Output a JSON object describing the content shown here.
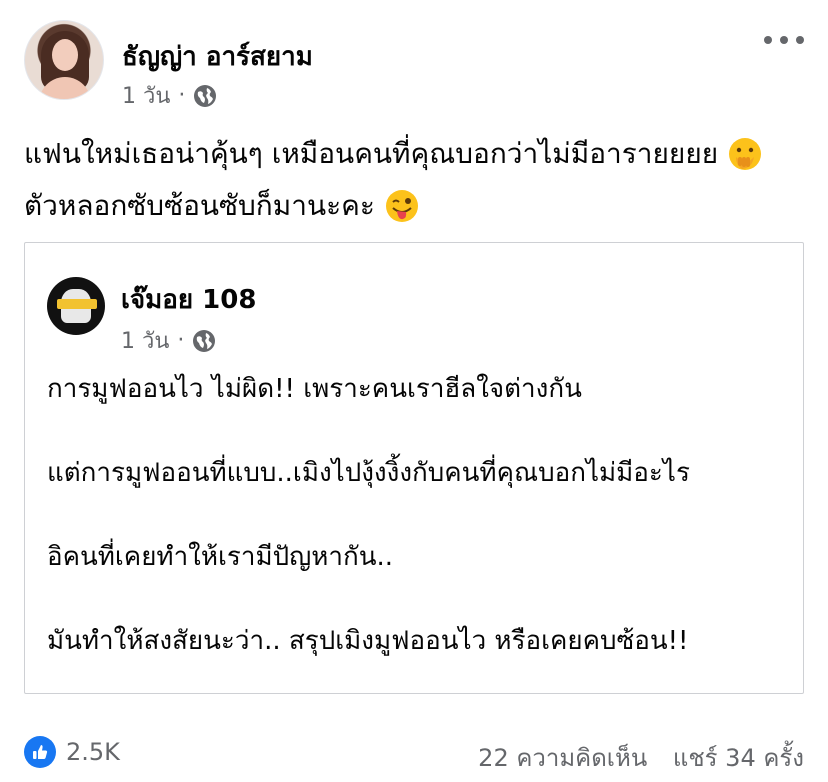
{
  "post": {
    "author": "ธัญญ่า อาร์สยาม",
    "time": "1 วัน",
    "separator": "·",
    "audience_icon": "globe-icon",
    "more_icon": "more-options-icon",
    "text_line1": "แฟนใหม่เธอน่าคุ้นๆ เหมือนคนที่คุณบอกว่าไม่มีอารายยยย",
    "text_line1_emoji": "hand-over-mouth-emoji",
    "text_line2": "ตัวหลอกซับซ้อนซับก็มานะคะ",
    "text_line2_emoji": "winking-tongue-emoji"
  },
  "shared_post": {
    "author": "เจ๊มอย 108",
    "time": "1 วัน",
    "separator": "·",
    "audience_icon": "globe-icon",
    "paragraphs": [
      "การมูฟออนไว ไม่ผิด!! เพราะคนเราฮีลใจต่างกัน",
      "แต่การมูฟออนที่แบบ..เมิงไปงุ้งงิ้งกับคนที่คุณบอกไม่มีอะไร",
      "อิคนที่เคยทำให้เรามีปัญหากัน..",
      "มันทำให้สงสัยนะว่า.. สรุปเมิงมูฟออนไว หรือเคยคบซ้อน!!"
    ]
  },
  "footer": {
    "reaction_icon": "like-icon",
    "reaction_count": "2.5K",
    "comments": "22 ความคิดเห็น",
    "shares": "แชร์ 34 ครั้ง"
  },
  "colors": {
    "accent": "#1877f2",
    "text_primary": "#050505",
    "text_secondary": "#65676b",
    "border": "#ced0d4"
  }
}
